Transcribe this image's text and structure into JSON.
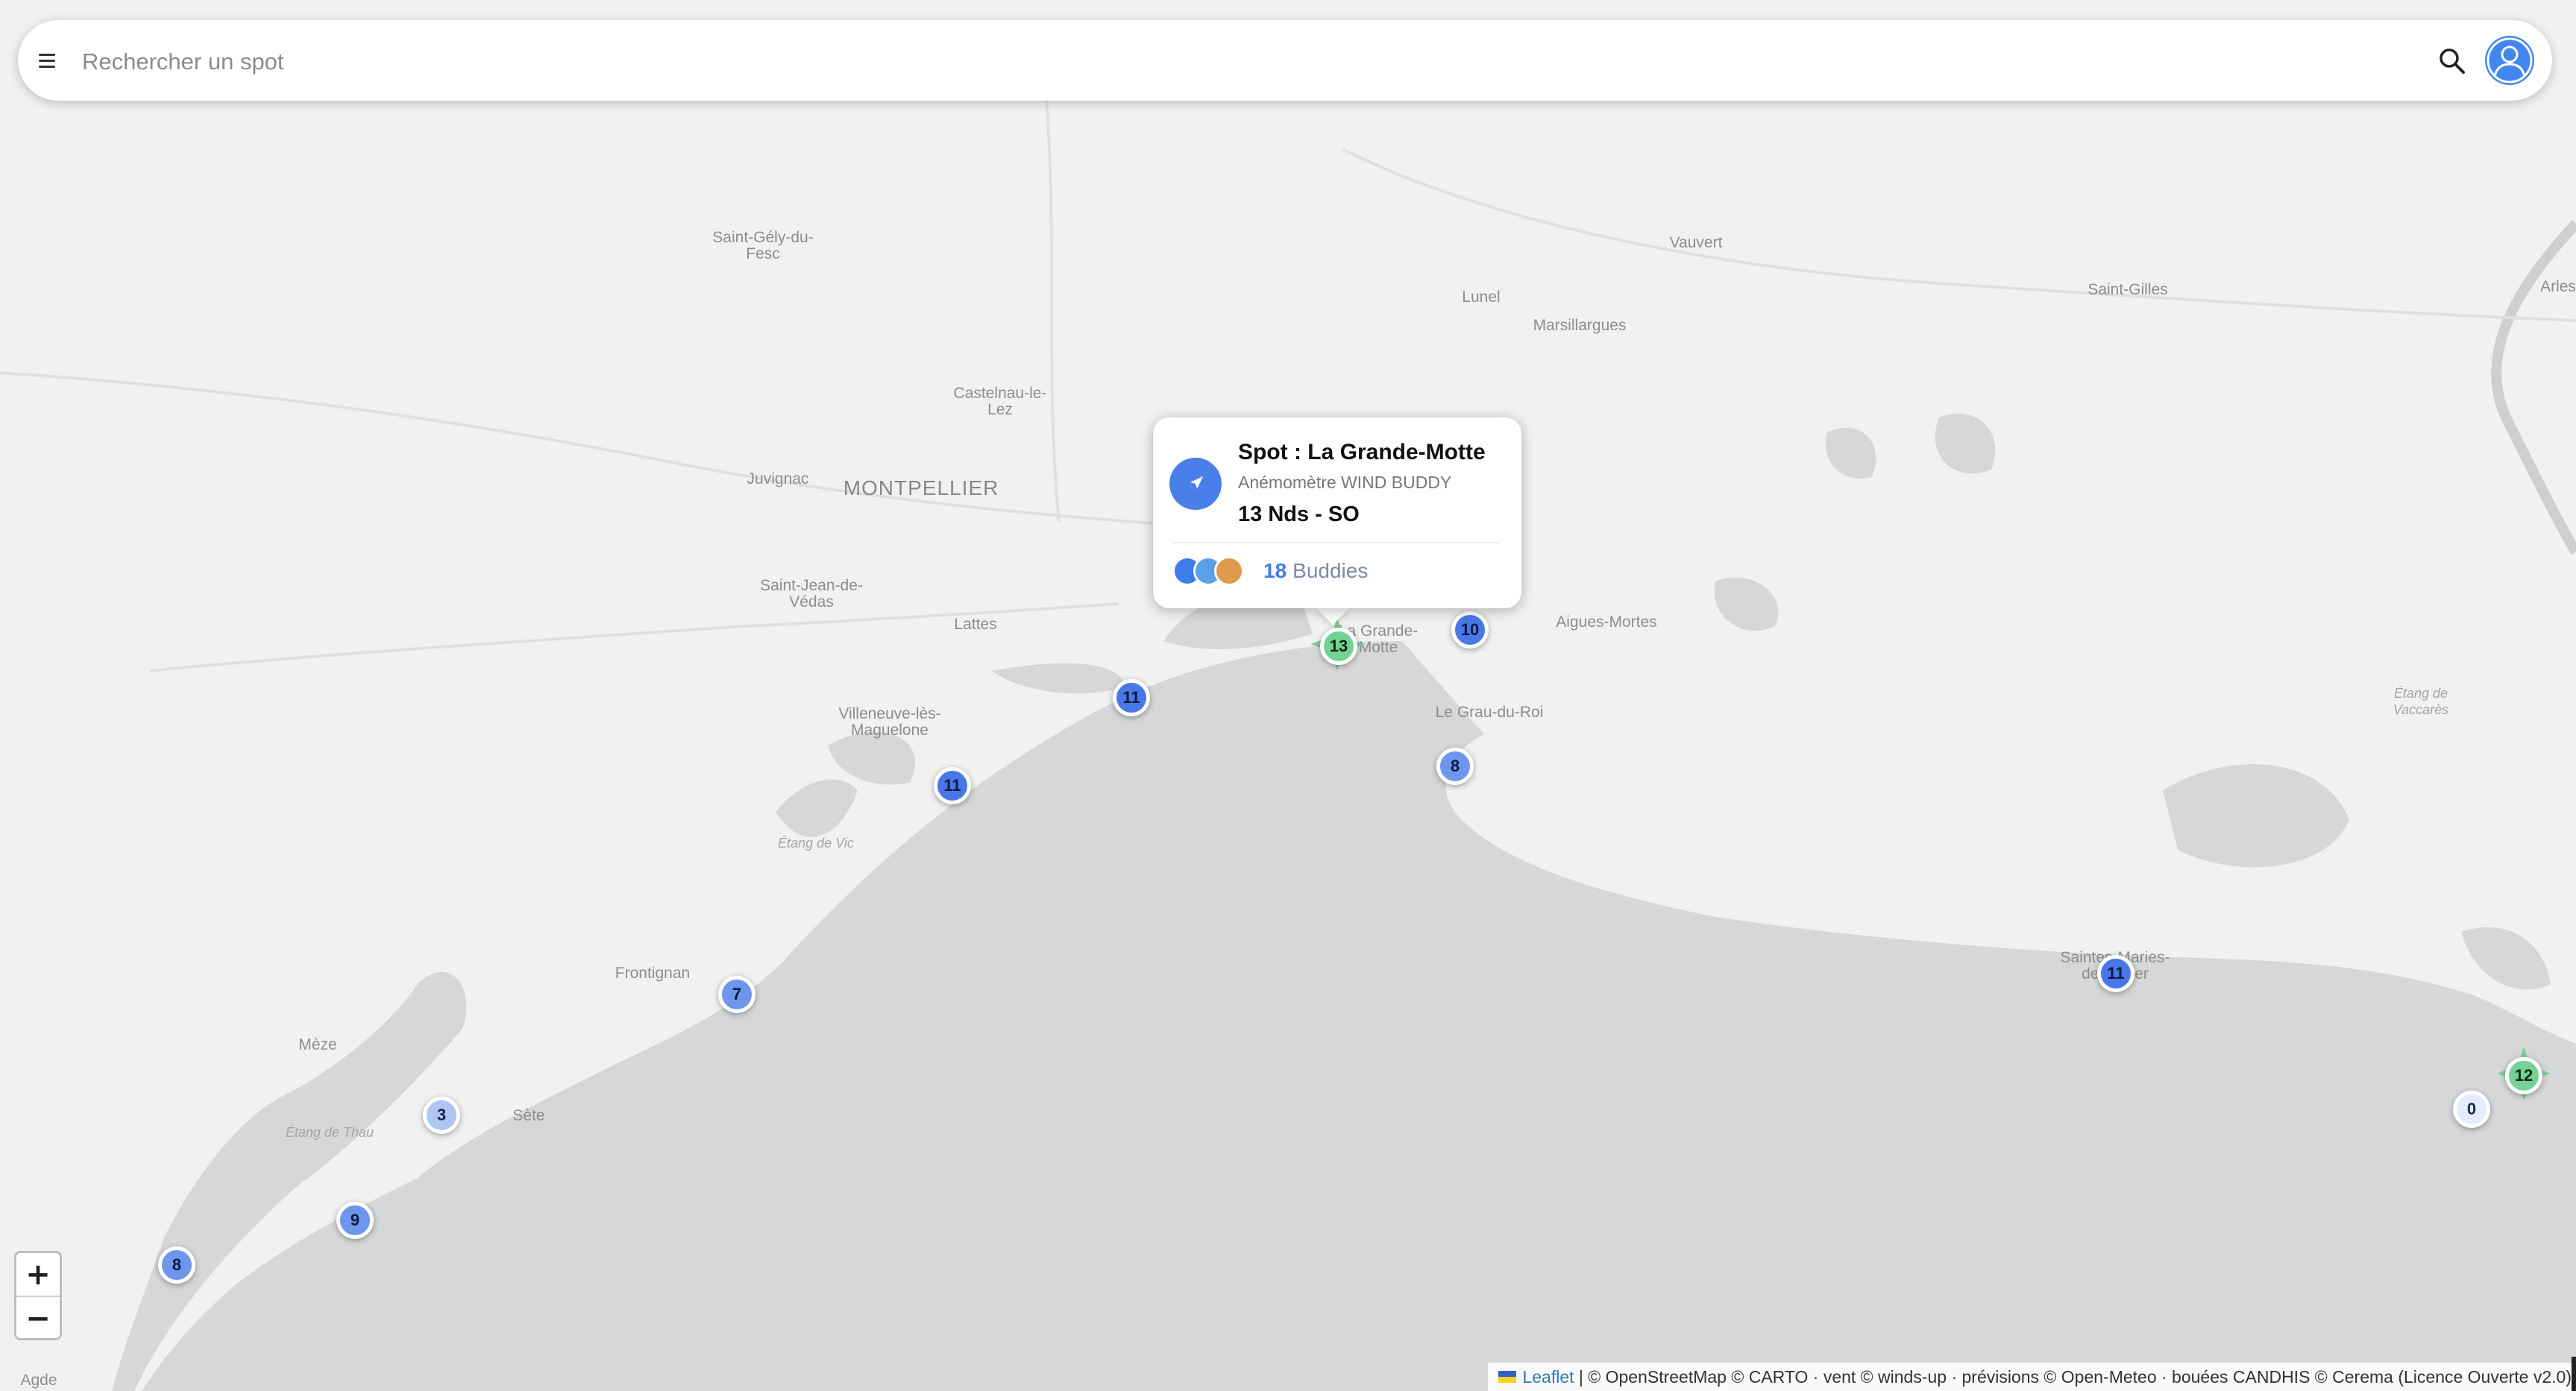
{
  "search": {
    "placeholder": "Rechercher un spot"
  },
  "places": [
    {
      "label": "Saint-Gély-du-\nFesc",
      "cls": "place"
    },
    {
      "label": "Vauvert",
      "cls": "place"
    },
    {
      "label": "Lunel",
      "cls": "place"
    },
    {
      "label": "Saint-Gilles",
      "cls": "place"
    },
    {
      "label": "Arles",
      "cls": "place"
    },
    {
      "label": "Marsillargues",
      "cls": "place"
    },
    {
      "label": "Castelnau-le-\nLez",
      "cls": "place"
    },
    {
      "label": "Juvignac",
      "cls": "place"
    },
    {
      "label": "MONTPELLIER",
      "cls": "place city"
    },
    {
      "label": "Saint-Jean-de-\nVédas",
      "cls": "place"
    },
    {
      "label": "Lattes",
      "cls": "place"
    },
    {
      "label": "Aigues-Mortes",
      "cls": "place"
    },
    {
      "label": "La Grande-\nMotte",
      "cls": "place"
    },
    {
      "label": "Le Grau-du-Roi",
      "cls": "place"
    },
    {
      "label": "Villeneuve-lès-\nMaguelone",
      "cls": "place"
    },
    {
      "label": "Étang de\nVaccarès",
      "cls": "place water"
    },
    {
      "label": "Étang de Vic",
      "cls": "place water"
    },
    {
      "label": "Frontignan",
      "cls": "place"
    },
    {
      "label": "Saintes-Maries-\nde-la-Mer",
      "cls": "place"
    },
    {
      "label": "Mèze",
      "cls": "place"
    },
    {
      "label": "Étang de Thau",
      "cls": "place water"
    },
    {
      "label": "Sète",
      "cls": "place"
    },
    {
      "label": "Agde",
      "cls": "place"
    }
  ],
  "markers": [
    {
      "value": "11",
      "tone": "m-blue"
    },
    {
      "value": "11",
      "tone": "m-blue"
    },
    {
      "value": "10",
      "tone": "m-blue"
    },
    {
      "value": "8",
      "tone": "m-mid"
    },
    {
      "value": "7",
      "tone": "m-mid"
    },
    {
      "value": "3",
      "tone": "m-light"
    },
    {
      "value": "9",
      "tone": "m-mid"
    },
    {
      "value": "8",
      "tone": "m-mid"
    },
    {
      "value": "11",
      "tone": "m-blue"
    },
    {
      "value": "0",
      "tone": "m-pale"
    },
    {
      "value": "13",
      "tone": "m-green"
    },
    {
      "value": "12",
      "tone": "m-green"
    }
  ],
  "popup": {
    "title": "Spot : La Grande-Motte",
    "subtitle": "Anémomètre WIND BUDDY",
    "wind": "13 Nds - SO",
    "buddies_count": "18",
    "buddies_label": "Buddies"
  },
  "zoom": {
    "in": "+",
    "out": "−"
  },
  "attribution": {
    "leaflet": "Leaflet",
    "text": "| © OpenStreetMap © CARTO · vent © winds-up · prévisions © Open-Meteo · bouées CANDHIS © Cerema (Licence Ouverte v2.0)"
  },
  "colors": {
    "sea": "#d6d7d8",
    "land": "#f1f1f0",
    "accent": "#3f7de9"
  }
}
